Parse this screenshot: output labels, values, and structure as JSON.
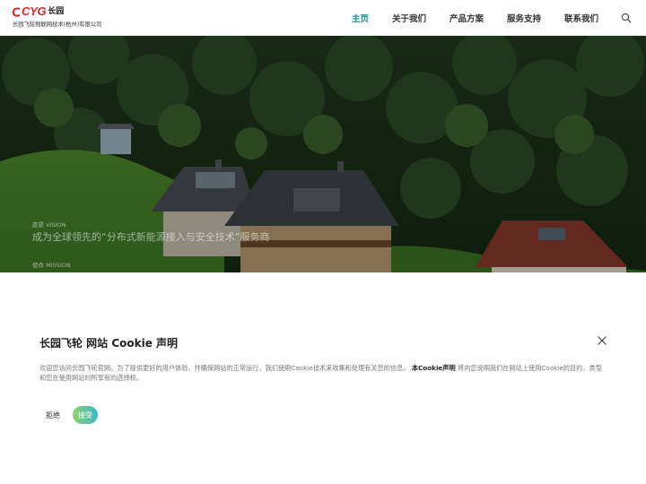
{
  "header": {
    "logo": {
      "brand_latin": "CYG",
      "brand_cn": "长园",
      "company": "长园飞轮物联网技术(杭州)有限公司"
    },
    "nav": [
      {
        "label": "主页",
        "active": true
      },
      {
        "label": "关于我们",
        "active": false
      },
      {
        "label": "产品方案",
        "active": false
      },
      {
        "label": "服务支持",
        "active": false
      },
      {
        "label": "联系我们",
        "active": false
      }
    ],
    "search_icon": "search-icon",
    "accent_color": "#1e8f86"
  },
  "hero": {
    "vision_label": "愿景 VISION",
    "vision_text": "成为全球领先的“分布式新能源接入与安全技术”服务商",
    "mission_label": "使命 MISSION"
  },
  "cookie": {
    "title": "长园飞轮 网站 Cookie 声明",
    "close_icon": "close-icon",
    "body_1": "欢迎您访问长园飞轮官网。为了提供更好的用户体验，并确保网站的正常运行，我们使用Cookie技术来收集和处理有关您的信息。",
    "body_link": "本Cookie声明",
    "body_2": "将向您说明我们在网站上使用Cookie的目的、类型和您在使用网站时所享有的选择权。",
    "reject_label": "拒绝",
    "accept_label": "接受",
    "accept_gradient": [
      "#8fd36e",
      "#3bb6c9"
    ]
  }
}
